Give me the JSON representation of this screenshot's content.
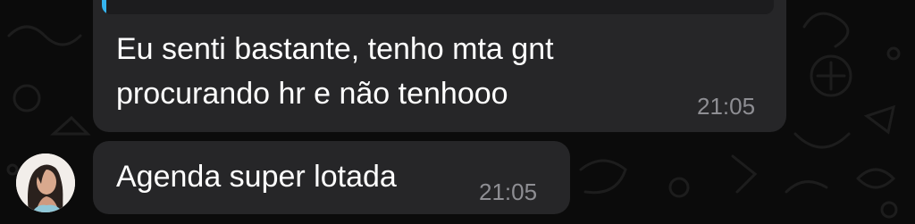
{
  "messages": [
    {
      "lines": [
        "Eu senti bastante, tenho mta gnt",
        "procurando hr e não tenhooo"
      ],
      "time": "21:05",
      "has_quoted_reply": true
    },
    {
      "lines": [
        "Agenda super lotada"
      ],
      "time": "21:05"
    }
  ],
  "colors": {
    "background": "#0b0b0b",
    "bubble": "#262628",
    "quote_accent": "#35b4ef",
    "timestamp": "#8e8e93",
    "text": "#ffffff"
  },
  "icons": {
    "avatar": "contact-avatar-photo",
    "wallpaper": "chat-doodle-wallpaper"
  }
}
